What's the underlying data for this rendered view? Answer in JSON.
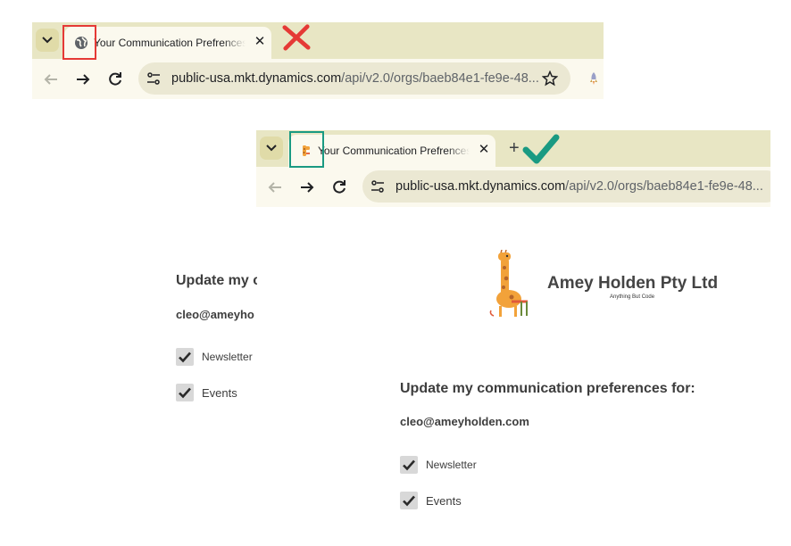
{
  "browser_before": {
    "tab_title": "Your Communication Prefrences",
    "favicon": "globe-icon",
    "url_domain": "public-usa.mkt.dynamics.com",
    "url_path": "/api/v2.0/orgs/baeb84e1-fe9e-48...",
    "marker": "red-cross-icon",
    "highlight_color": "#e53935"
  },
  "browser_after": {
    "tab_title": "Your Communication Prefrences",
    "favicon": "giraffe-icon",
    "url_domain": "public-usa.mkt.dynamics.com",
    "url_path": "/api/v2.0/orgs/baeb84e1-fe9e-48...",
    "new_tab": "+",
    "marker": "green-checkmark-icon",
    "highlight_color": "#1a9a82"
  },
  "page_before": {
    "heading": "Update my c",
    "email": "cleo@ameyho",
    "preferences": [
      {
        "label": "Newsletter",
        "checked": true
      },
      {
        "label": "Events",
        "checked": true
      }
    ]
  },
  "page_after": {
    "logo": {
      "company": "Amey Holden Pty Ltd",
      "tagline": "Anything But Code",
      "mascot": "giraffe-icon"
    },
    "heading": "Update my communication preferences for:",
    "email": "cleo@ameyholden.com",
    "preferences": [
      {
        "label": "Newsletter",
        "checked": true
      },
      {
        "label": "Events",
        "checked": true
      }
    ]
  },
  "colors": {
    "tabstrip": "#e8e6c4",
    "toolbar": "#fbf9ee",
    "red_marker": "#e53935",
    "green_marker": "#1a9a82"
  }
}
